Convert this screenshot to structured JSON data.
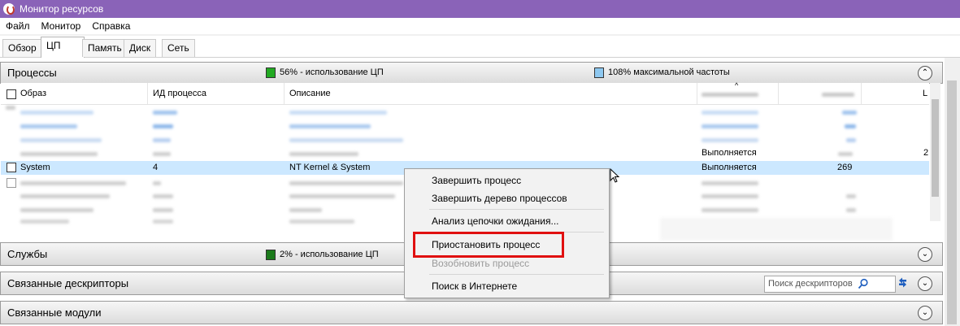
{
  "window": {
    "title": "Монитор ресурсов"
  },
  "menu": [
    "Файл",
    "Монитор",
    "Справка"
  ],
  "tabs": [
    "Обзор",
    "ЦП",
    "Память",
    "Диск",
    "Сеть"
  ],
  "processes": {
    "title": "Процессы",
    "cpu_usage": "56% - использование ЦП",
    "max_freq": "108% максимальной частоты",
    "cpu_color": "#22aa22",
    "freq_color": "#8ec8f0",
    "columns": [
      "Образ",
      "ИД процесса",
      "Описание"
    ],
    "selected_row": {
      "image": "System",
      "pid": "4",
      "description": "NT Kernel & System",
      "status": "Выполняется",
      "threads": "269"
    },
    "partial_row": {
      "status": "Выполняется"
    }
  },
  "services": {
    "title": "Службы",
    "cpu_usage": "2% - использование ЦП",
    "cpu_color": "#1b7a1b"
  },
  "handles": {
    "title": "Связанные дескрипторы",
    "search_placeholder": "Поиск дескрипторов"
  },
  "modules": {
    "title": "Связанные модули"
  },
  "context_menu": {
    "end_process": "Завершить процесс",
    "end_tree": "Завершить дерево процессов",
    "analyze_wait": "Анализ цепочки ожидания...",
    "suspend": "Приостановить процесс",
    "resume": "Возобновить процесс",
    "search_online": "Поиск в Интернете"
  }
}
